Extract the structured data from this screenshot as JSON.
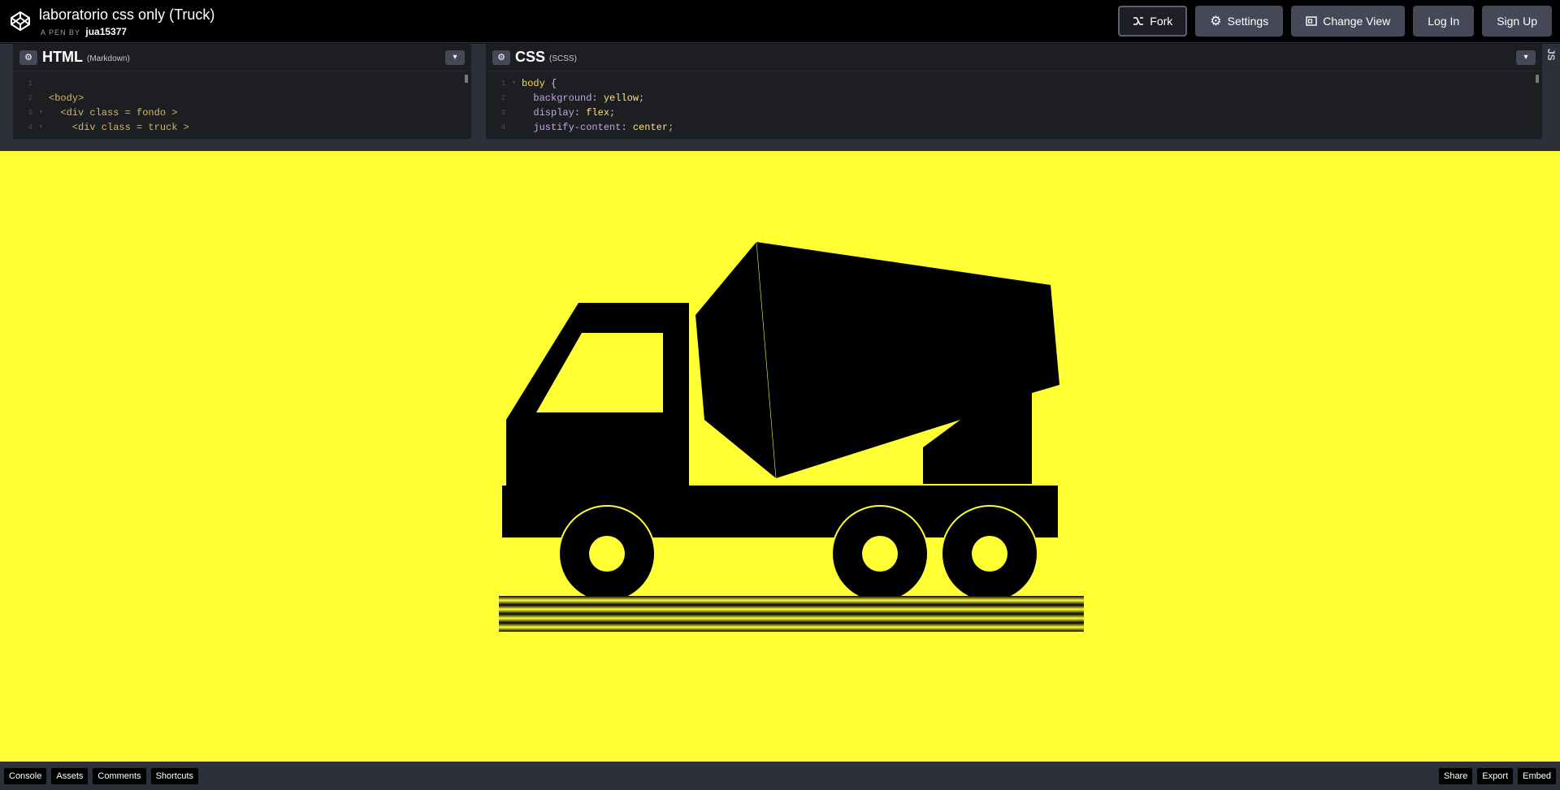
{
  "header": {
    "pen_title": "laboratorio css only (Truck)",
    "byline_prefix": "A PEN BY",
    "author": "jua15377",
    "buttons": {
      "fork": "Fork",
      "settings": "Settings",
      "change_view": "Change View",
      "login": "Log In",
      "signup": "Sign Up"
    }
  },
  "html_pane": {
    "lang": "HTML",
    "preprocessor": "(Markdown)",
    "lines": [
      {
        "n": "1",
        "text": ""
      },
      {
        "n": "2",
        "text": "<body>"
      },
      {
        "n": "3",
        "text": "  <div class = fondo >"
      },
      {
        "n": "4",
        "text": "    <div class = truck >"
      }
    ]
  },
  "css_pane": {
    "lang": "CSS",
    "preprocessor": "(SCSS)",
    "lines": [
      {
        "n": "1",
        "sel": "body",
        "text": " {"
      },
      {
        "n": "2",
        "prop": "background",
        "value": "yellow"
      },
      {
        "n": "3",
        "prop": "display",
        "value": "flex"
      },
      {
        "n": "4",
        "prop": "justify-content",
        "value": "center"
      }
    ]
  },
  "js_tab": "JS",
  "preview": {
    "background": "#ffff33"
  },
  "bottombar": {
    "left": [
      "Console",
      "Assets",
      "Comments",
      "Shortcuts"
    ],
    "right": [
      "Share",
      "Export",
      "Embed"
    ]
  }
}
